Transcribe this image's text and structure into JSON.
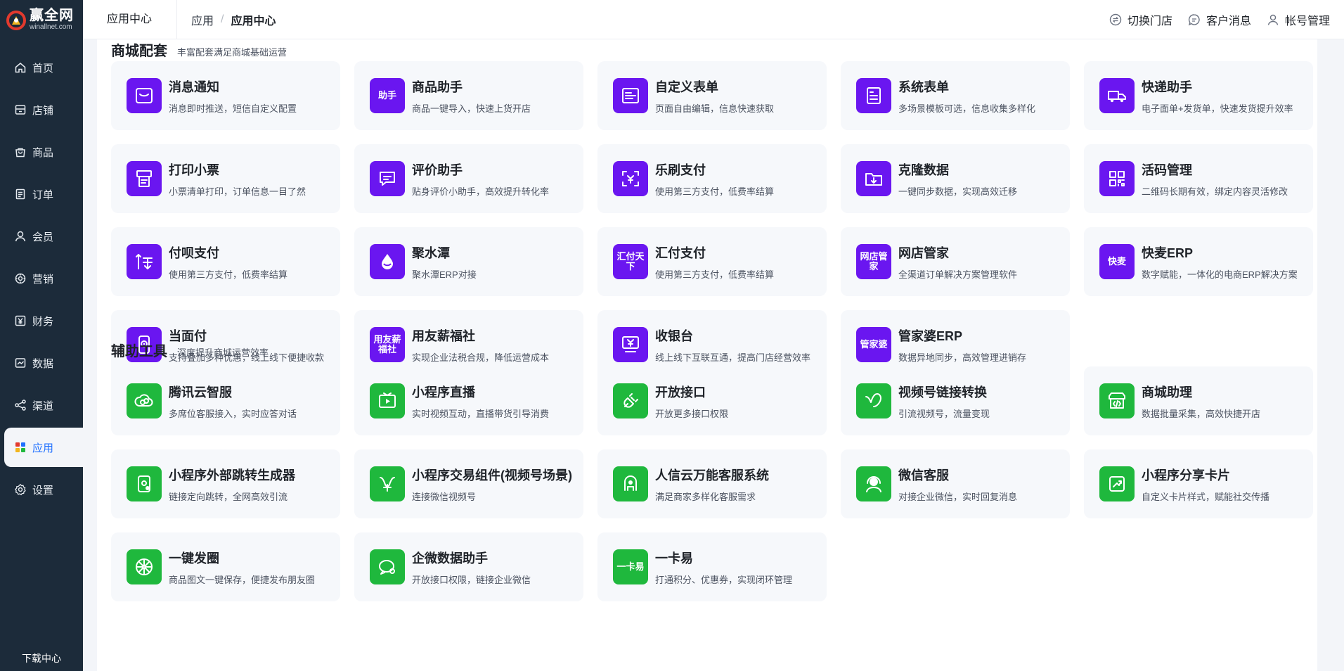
{
  "brand": {
    "name": "赢全网",
    "url": "winallnet.com",
    "colors": {
      "sidebar": "#1c2b3a",
      "accent": "#1e6fff",
      "purple": "#6a16f0",
      "green": "#1fb83d"
    }
  },
  "sidebar": {
    "items": [
      {
        "label": "首页",
        "icon": "home-icon"
      },
      {
        "label": "店铺",
        "icon": "store-icon"
      },
      {
        "label": "商品",
        "icon": "bag-icon"
      },
      {
        "label": "订单",
        "icon": "order-icon"
      },
      {
        "label": "会员",
        "icon": "user-icon"
      },
      {
        "label": "营销",
        "icon": "gear-icon"
      },
      {
        "label": "财务",
        "icon": "yen-icon"
      },
      {
        "label": "数据",
        "icon": "chart-icon"
      },
      {
        "label": "渠道",
        "icon": "share-icon"
      },
      {
        "label": "应用",
        "icon": "apps-icon",
        "active": true
      },
      {
        "label": "设置",
        "icon": "settings-icon"
      }
    ],
    "download": "下载中心"
  },
  "topbar": {
    "title": "应用中心",
    "breadcrumb": [
      "应用",
      "应用中心"
    ],
    "separator": "/",
    "actions": [
      {
        "label": "切换门店",
        "icon": "switch-icon"
      },
      {
        "label": "客户消息",
        "icon": "message-icon"
      },
      {
        "label": "帐号管理",
        "icon": "account-icon"
      }
    ]
  },
  "sections": [
    {
      "title": "商城配套",
      "subtitle": "丰富配套满足商城基础运营",
      "cards": [
        {
          "title": "消息通知",
          "desc": "消息即时推送，短信自定义配置",
          "icon": "message-notify-icon"
        },
        {
          "title": "商品助手",
          "desc": "商品一键导入，快速上货开店",
          "icon": "goods-helper-icon",
          "icon_text": "助手"
        },
        {
          "title": "自定义表单",
          "desc": "页面自由编辑，信息快速获取",
          "icon": "custom-form-icon"
        },
        {
          "title": "系统表单",
          "desc": "多场景模板可选，信息收集多样化",
          "icon": "system-form-icon"
        },
        {
          "title": "快递助手",
          "desc": "电子面单+发货单，快速发货提升效率",
          "icon": "truck-icon"
        },
        {
          "title": "打印小票",
          "desc": "小票清单打印，订单信息一目了然",
          "icon": "printer-icon"
        },
        {
          "title": "评价助手",
          "desc": "贴身评价小助手，高效提升转化率",
          "icon": "comment-icon"
        },
        {
          "title": "乐刷支付",
          "desc": "使用第三方支付，低费率结算",
          "icon": "scan-pay-icon"
        },
        {
          "title": "克隆数据",
          "desc": "一键同步数据，实现高效迁移",
          "icon": "clone-folder-icon"
        },
        {
          "title": "活码管理",
          "desc": "二维码长期有效，绑定内容灵活修改",
          "icon": "qrcode-icon"
        },
        {
          "title": "付呗支付",
          "desc": "使用第三方支付，低费率结算",
          "icon": "fubei-icon"
        },
        {
          "title": "聚水潭",
          "desc": "聚水潭ERP对接",
          "icon": "water-drop-icon"
        },
        {
          "title": "汇付支付",
          "desc": "使用第三方支付，低费率结算",
          "icon": "huifu-icon",
          "icon_text": "汇付天下"
        },
        {
          "title": "网店管家",
          "desc": "全渠道订单解决方案管理软件",
          "icon": "shop-manager-icon",
          "icon_text": "网店管家"
        },
        {
          "title": "快麦ERP",
          "desc": "数字赋能，一体化的电商ERP解决方案",
          "icon": "kuaimai-icon",
          "icon_text": "快麦"
        },
        {
          "title": "当面付",
          "desc": "支持叠加多种优惠，线上线下便捷收款",
          "icon": "face-pay-icon"
        },
        {
          "title": "用友薪福社",
          "desc": "实现企业法税合规，降低运营成本",
          "icon": "yonyou-icon",
          "icon_text": "用友薪福社"
        },
        {
          "title": "收银台",
          "desc": "线上线下互联互通，提高门店经营效率",
          "icon": "cashier-icon"
        },
        {
          "title": "管家婆ERP",
          "desc": "数据异地同步，高效管理进销存",
          "icon": "guanjiapo-icon",
          "icon_text": "管家婆"
        }
      ]
    },
    {
      "title": "辅助工具",
      "subtitle": "深度提升商城运营效率",
      "cards": [
        {
          "title": "腾讯云智服",
          "desc": "多席位客服接入，实时应答对话",
          "icon": "cloud-link-icon"
        },
        {
          "title": "小程序直播",
          "desc": "实时视频互动，直播带货引导消费",
          "icon": "live-tv-icon"
        },
        {
          "title": "开放接口",
          "desc": "开放更多接口权限",
          "icon": "plug-icon"
        },
        {
          "title": "视频号链接转换",
          "desc": "引流视频号，流量变现",
          "icon": "video-channel-icon"
        },
        {
          "title": "商城助理",
          "desc": "数据批量采集，高效快捷开店",
          "icon": "shop-code-icon"
        },
        {
          "title": "小程序外部跳转生成器",
          "desc": "链接定向跳转，全网高效引流",
          "icon": "jump-link-icon"
        },
        {
          "title": "小程序交易组件(视频号场景)",
          "desc": "连接微信视频号",
          "icon": "trade-component-icon"
        },
        {
          "title": "人信云万能客服系统",
          "desc": "满足商家多样化客服需求",
          "icon": "service-system-icon"
        },
        {
          "title": "微信客服",
          "desc": "对接企业微信，实时回复消息",
          "icon": "headset-icon"
        },
        {
          "title": "小程序分享卡片",
          "desc": "自定义卡片样式，赋能社交传播",
          "icon": "share-card-icon"
        },
        {
          "title": "一键发圈",
          "desc": "商品图文一键保存，便捷发布朋友圈",
          "icon": "moments-icon"
        },
        {
          "title": "企微数据助手",
          "desc": "开放接口权限，链接企业微信",
          "icon": "wecom-icon"
        },
        {
          "title": "一卡易",
          "desc": "打通积分、优惠券，实现闭环管理",
          "icon": "card-icon",
          "icon_text": "一卡易"
        }
      ]
    }
  ]
}
